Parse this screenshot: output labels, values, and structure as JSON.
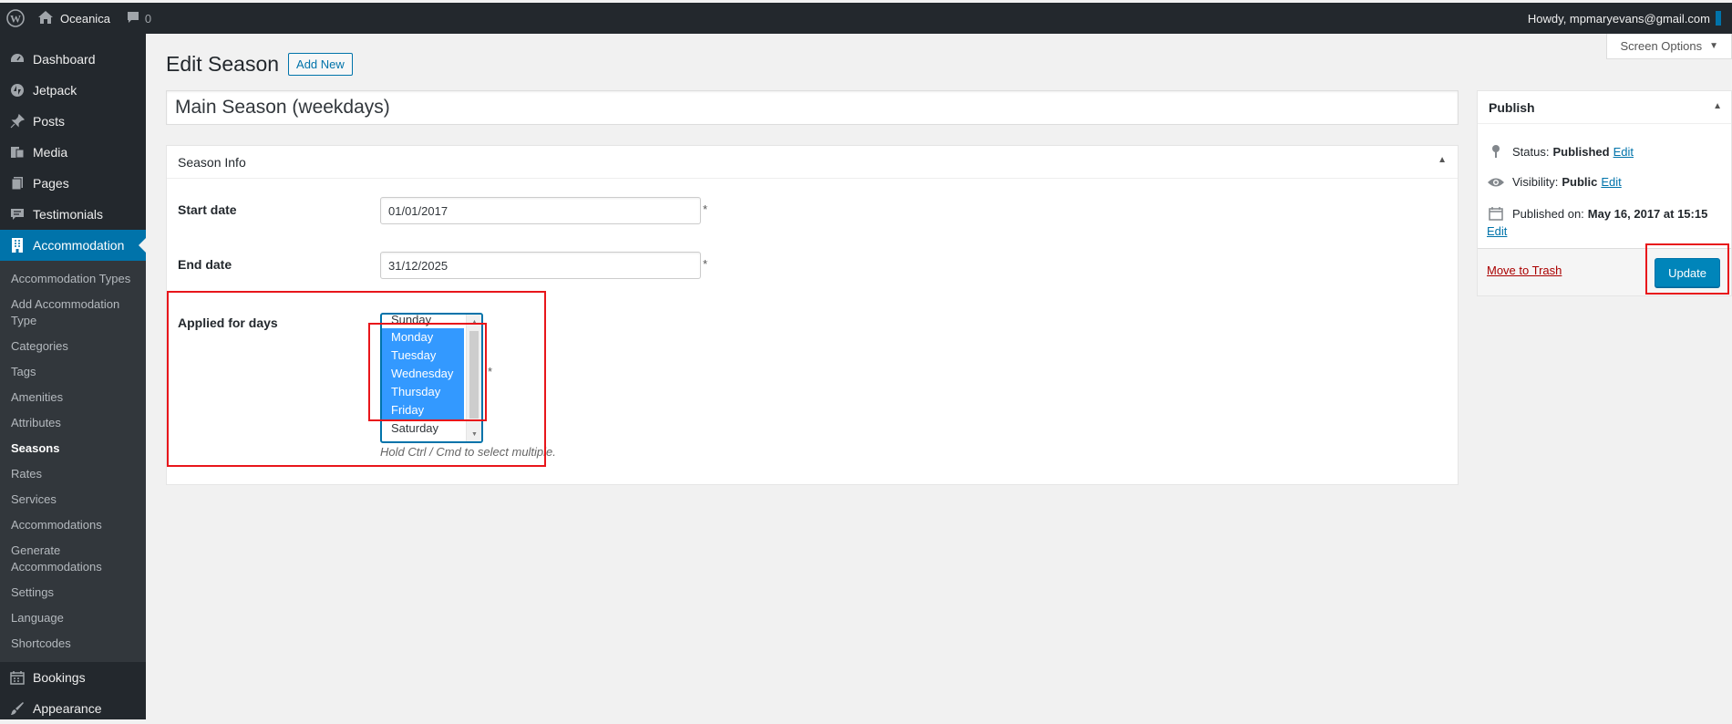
{
  "adminbar": {
    "site_name": "Oceanica",
    "comments_count": "0",
    "howdy": "Howdy, mpmaryevans@gmail.com"
  },
  "sidebar": {
    "top_items": [
      {
        "label": "Dashboard",
        "icon": "dashboard-icon"
      },
      {
        "label": "Jetpack",
        "icon": "jetpack-icon"
      },
      {
        "label": "Posts",
        "icon": "pin-icon"
      },
      {
        "label": "Media",
        "icon": "media-icon"
      },
      {
        "label": "Pages",
        "icon": "pages-icon"
      },
      {
        "label": "Testimonials",
        "icon": "testimonials-icon"
      }
    ],
    "active": {
      "label": "Accommodation",
      "icon": "building-icon"
    },
    "submenu": [
      "Accommodation Types",
      "Add Accommodation Type",
      "Categories",
      "Tags",
      "Amenities",
      "Attributes",
      "Seasons",
      "Rates",
      "Services",
      "Accommodations",
      "Generate Accommodations",
      "Settings",
      "Language",
      "Shortcodes"
    ],
    "current_sub": "Seasons",
    "bottom_items": [
      {
        "label": "Bookings",
        "icon": "calendar-icon"
      },
      {
        "label": "Appearance",
        "icon": "brush-icon"
      }
    ]
  },
  "header": {
    "screen_options": "Screen Options",
    "title": "Edit Season",
    "add_new": "Add New",
    "post_title": "Main Season (weekdays)"
  },
  "season_info": {
    "heading": "Season Info",
    "start_label": "Start date",
    "start_value": "01/01/2017",
    "end_label": "End date",
    "end_value": "31/12/2025",
    "days_label": "Applied for days",
    "days": [
      {
        "name": "Sunday",
        "selected": false
      },
      {
        "name": "Monday",
        "selected": true
      },
      {
        "name": "Tuesday",
        "selected": true
      },
      {
        "name": "Wednesday",
        "selected": true
      },
      {
        "name": "Thursday",
        "selected": true
      },
      {
        "name": "Friday",
        "selected": true
      },
      {
        "name": "Saturday",
        "selected": false
      }
    ],
    "hint": "Hold Ctrl / Cmd to select multiple.",
    "required_mark": "*"
  },
  "publish": {
    "heading": "Publish",
    "status_label": "Status:",
    "status_value": "Published",
    "visibility_label": "Visibility:",
    "visibility_value": "Public",
    "published_label": "Published on:",
    "published_value": "May 16, 2017 at 15:15",
    "edit": "Edit",
    "trash": "Move to Trash",
    "update": "Update"
  },
  "colors": {
    "adminbar": "#23282d",
    "accent": "#0073aa",
    "selection": "#3399ff",
    "annotation": "#e8161b"
  }
}
